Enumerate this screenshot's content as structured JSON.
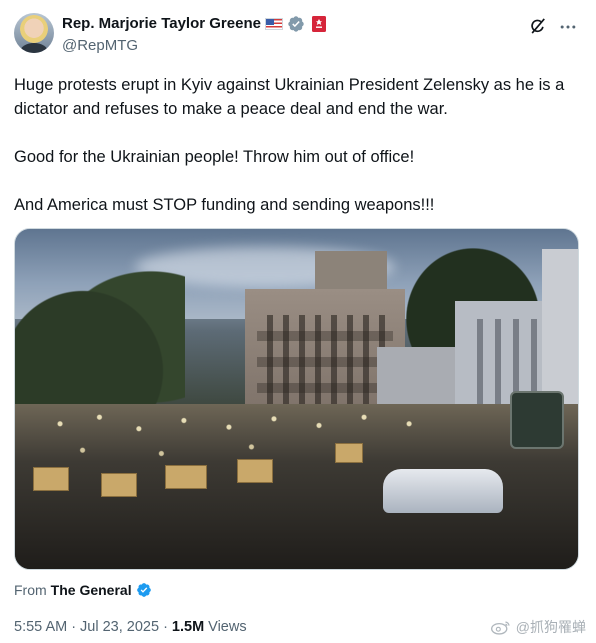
{
  "author": {
    "display_name": "Rep. Marjorie Taylor Greene",
    "handle": "@RepMTG",
    "flag_icon": "us-flag-icon",
    "verified_icon": "verified-gray-badge-icon",
    "affiliation_icon": "government-badge-icon"
  },
  "header_actions": {
    "grok_icon": "grok-icon",
    "more_icon": "more-icon"
  },
  "tweet": {
    "paragraphs": [
      "Huge protests erupt in Kyiv against Ukrainian President Zelensky as he is a dictator and refuses to make a peace deal and end the war.",
      "Good for the Ukrainian people! Throw him out of office!",
      "And America must STOP funding and sending weapons!!!"
    ]
  },
  "media": {
    "type": "video",
    "description_icon": "crowd-video-thumbnail"
  },
  "source": {
    "prefix": "From",
    "name": "The General",
    "verified_icon": "verified-blue-badge-icon"
  },
  "meta": {
    "time": "5:55 AM",
    "separator": "·",
    "date": "Jul 23, 2025",
    "views_count": "1.5M",
    "views_label": "Views"
  },
  "watermark": {
    "icon": "weibo-icon",
    "text": "@抓狗罹蝉"
  },
  "colors": {
    "text_primary": "#0f1419",
    "text_secondary": "#536471",
    "verified_blue": "#1d9bf0",
    "verified_gray": "#829aab",
    "gov_badge": "#d6253a",
    "border": "#cfd9de"
  }
}
